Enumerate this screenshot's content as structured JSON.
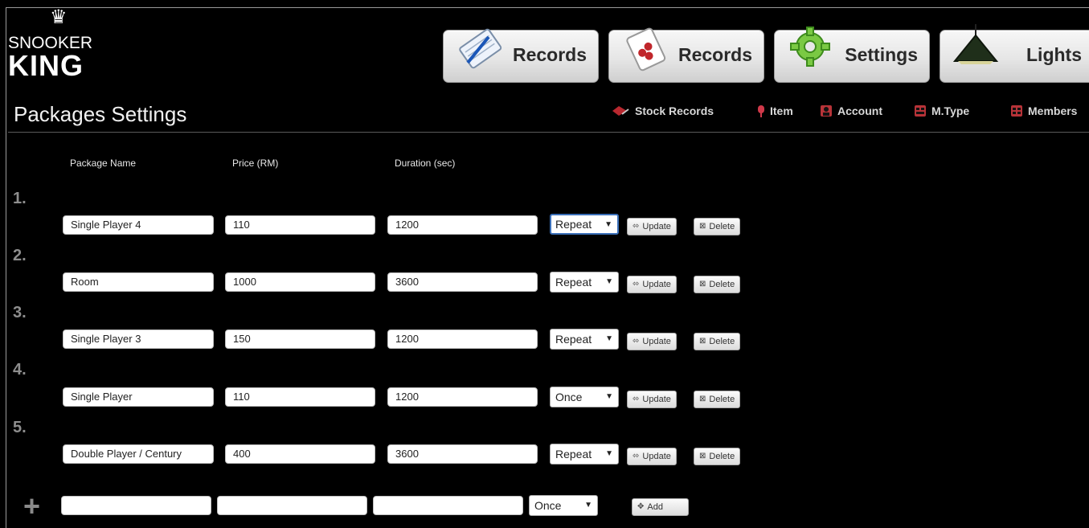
{
  "logo": {
    "line1": "SNOOKER",
    "line2": "KING",
    "crown": "♛"
  },
  "nav": [
    {
      "label": "Records",
      "icon": "notepad-icon"
    },
    {
      "label": "Records",
      "icon": "cards-icon"
    },
    {
      "label": "Settings",
      "icon": "gear-icon"
    },
    {
      "label": "Lights",
      "icon": "lamp-icon"
    }
  ],
  "page_title": "Packages Settings",
  "subnav": [
    {
      "label": "Stock Records",
      "icon": "stock-icon"
    },
    {
      "label": "Item",
      "icon": "item-icon"
    },
    {
      "label": "Account",
      "icon": "account-icon"
    },
    {
      "label": "M.Type",
      "icon": "member-type-icon"
    },
    {
      "label": "Members",
      "icon": "members-icon"
    }
  ],
  "columns": {
    "name": "Package Name",
    "price": "Price (RM)",
    "duration": "Duration (sec)"
  },
  "rows": [
    {
      "num": "1.",
      "name": "Single Player 4",
      "price": "110",
      "duration": "1200",
      "mode": "Repeat"
    },
    {
      "num": "2.",
      "name": "Room",
      "price": "1000",
      "duration": "3600",
      "mode": "Repeat"
    },
    {
      "num": "3.",
      "name": "Single Player 3",
      "price": "150",
      "duration": "1200",
      "mode": "Repeat"
    },
    {
      "num": "4.",
      "name": "Single Player",
      "price": "110",
      "duration": "1200",
      "mode": "Once"
    },
    {
      "num": "5.",
      "name": "Double Player / Century",
      "price": "400",
      "duration": "3600",
      "mode": "Repeat"
    }
  ],
  "buttons": {
    "update": "Update",
    "delete": "Delete",
    "add": "Add"
  },
  "new_row": {
    "name": "",
    "price": "",
    "duration": "",
    "mode": "Once"
  }
}
